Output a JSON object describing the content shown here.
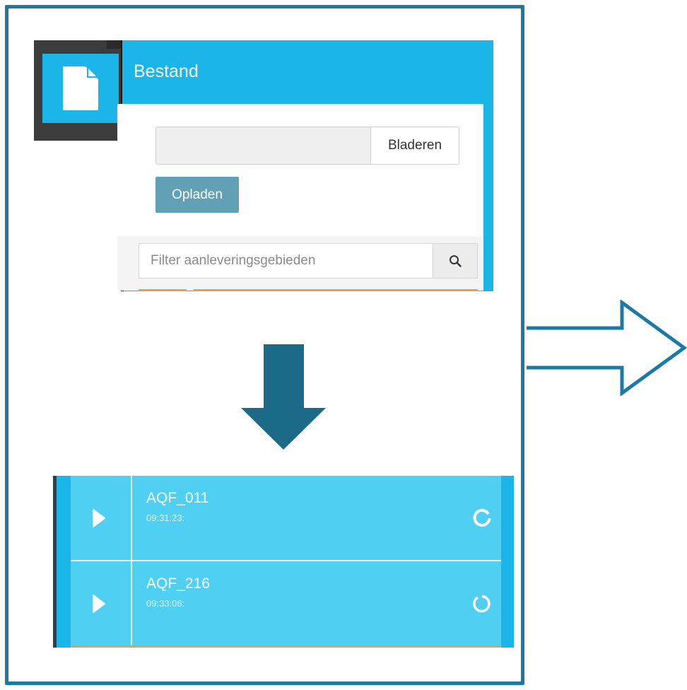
{
  "colors": {
    "frame": "#1b7aa3",
    "accent_blue": "#1cb5ea",
    "list_blue": "#4fd0f3",
    "upload_button": "#62a0b6",
    "dark": "#3c3c3c",
    "orange": "#e0a050"
  },
  "upload_panel": {
    "title": "Bestand",
    "title_icon": "file-icon",
    "browse_label": "Bladeren",
    "file_value": "",
    "upload_label": "Opladen",
    "filter_placeholder": "Filter aanleveringsgebieden",
    "filter_icon": "search-icon"
  },
  "flow_arrows": [
    "arrow-down-icon",
    "arrow-right-icon"
  ],
  "list": {
    "items": [
      {
        "title": "AQF_011",
        "time": "09:31:23:",
        "left_icon": "play-icon",
        "status_icon": "refresh-icon"
      },
      {
        "title": "AQF_216",
        "time": "09:33:06:",
        "left_icon": "play-icon",
        "status_icon": "refresh-icon"
      }
    ]
  }
}
